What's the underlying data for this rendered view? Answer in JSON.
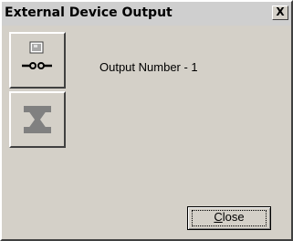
{
  "window": {
    "title": "External Device Output",
    "close_glyph": "X"
  },
  "buttons": {
    "output_icon": "switch-connector-icon",
    "disabled_icon": "disabled-connector-icon"
  },
  "content": {
    "output_label": "Output Number - 1"
  },
  "footer": {
    "close_mnemonic": "C",
    "close_rest": "lose"
  },
  "colors": {
    "face": "#d4d0c8",
    "titlebar": "#cfcfcf",
    "led": "#a8a8a8",
    "disabled_glyph": "#808080"
  }
}
